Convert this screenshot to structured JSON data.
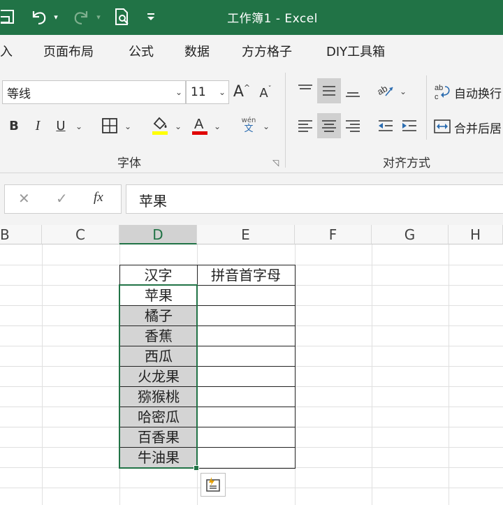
{
  "title_bar": {
    "title": "工作簿1  -  Excel",
    "accent_color": "#217346"
  },
  "tabs": [
    {
      "label": "插入",
      "visible_text": "入"
    },
    {
      "label": "页面布局"
    },
    {
      "label": "公式"
    },
    {
      "label": "数据"
    },
    {
      "label": "方方格子"
    },
    {
      "label": "DIY工具箱"
    }
  ],
  "font_group": {
    "font_name": "等线",
    "font_size": "11",
    "label": "字体",
    "bold": "B",
    "italic": "I",
    "underline": "U",
    "phonetic_top": "wén",
    "phonetic_bottom": "文"
  },
  "alignment_group": {
    "wrap_text": "自动换行",
    "merge_center": "合并后居",
    "label": "对齐方式"
  },
  "formula_bar": {
    "value": "苹果",
    "fx_label": "fx"
  },
  "columns": [
    "B",
    "C",
    "D",
    "E",
    "F",
    "G",
    "H"
  ],
  "active_column": "D",
  "table": {
    "headers": [
      "汉字",
      "拼音首字母"
    ],
    "rows": [
      "苹果",
      "橘子",
      "香蕉",
      "西瓜",
      "火龙果",
      "猕猴桃",
      "哈密瓜",
      "百香果",
      "牛油果"
    ]
  },
  "icons": [
    "save-icon",
    "undo-icon",
    "redo-icon",
    "print-preview-icon",
    "customize-qat-icon",
    "increase-font-icon",
    "decrease-font-icon",
    "border-icon",
    "fill-color-icon",
    "font-color-icon",
    "align-top-icon",
    "align-middle-icon",
    "align-bottom-icon",
    "orientation-icon",
    "align-left-icon",
    "align-center-icon",
    "align-right-icon",
    "decrease-indent-icon",
    "increase-indent-icon",
    "quick-analysis-icon"
  ]
}
